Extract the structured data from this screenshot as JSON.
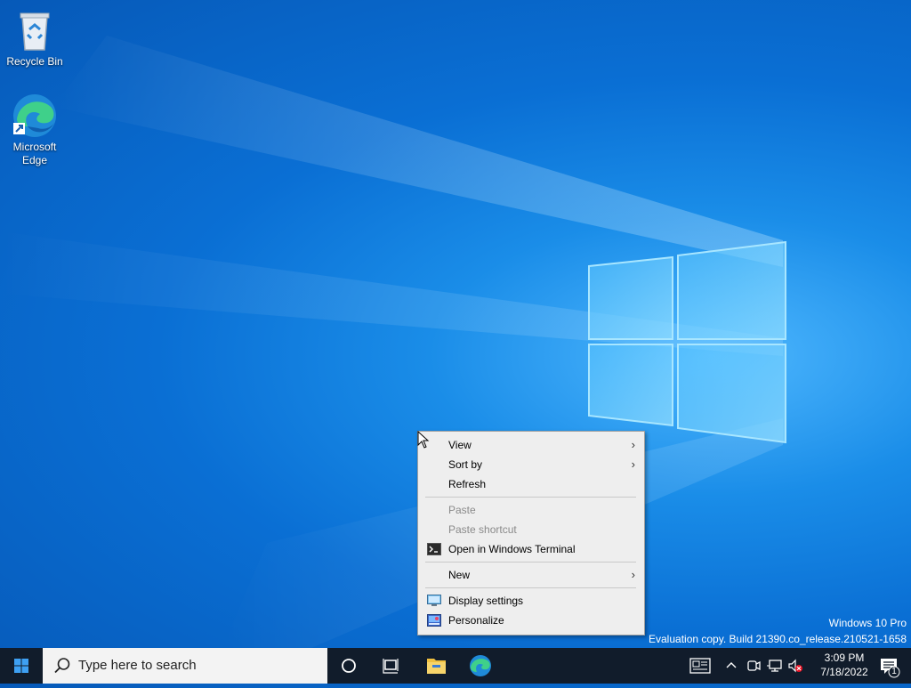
{
  "desktop": {
    "icons": [
      {
        "label": "Recycle Bin"
      },
      {
        "label": "Microsoft\nEdge"
      }
    ],
    "watermark": {
      "line1": "Windows 10 Pro",
      "line2": "Evaluation copy. Build 21390.co_release.210521-1658"
    }
  },
  "context_menu": {
    "items": [
      {
        "label": "View",
        "submenu": true
      },
      {
        "label": "Sort by",
        "submenu": true
      },
      {
        "label": "Refresh"
      },
      {
        "label": "Paste",
        "disabled": true
      },
      {
        "label": "Paste shortcut",
        "disabled": true
      },
      {
        "label": "Open in Windows Terminal",
        "icon": "terminal-icon"
      },
      {
        "label": "New",
        "submenu": true
      },
      {
        "label": "Display settings",
        "icon": "display-icon"
      },
      {
        "label": "Personalize",
        "icon": "personalize-icon"
      }
    ],
    "arrow": "›"
  },
  "taskbar": {
    "search_placeholder": "Type here to search",
    "time": "3:09 PM",
    "date": "7/18/2022",
    "notification_count": "1"
  },
  "colors": {
    "taskbar_bg": "#111c2b",
    "accent": "#0078d7"
  }
}
